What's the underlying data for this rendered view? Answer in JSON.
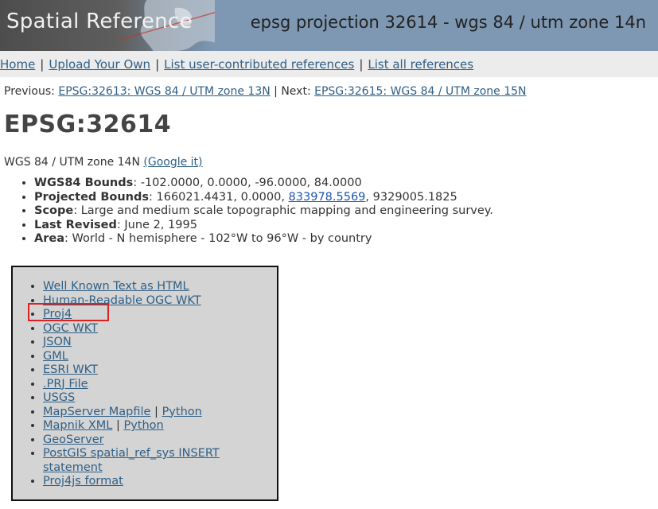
{
  "header": {
    "logo_text": "Spatial Reference",
    "title": "epsg projection 32614 - wgs 84 / utm zone 14n"
  },
  "nav": {
    "home": "Home",
    "upload": "Upload Your Own",
    "user_refs": "List user-contributed references",
    "all_refs": "List all references",
    "sep": "|"
  },
  "prevnext": {
    "prev_label": "Previous:",
    "prev_link": "EPSG:32613: WGS 84 / UTM zone 13N",
    "sep": " | Next: ",
    "next_link": "EPSG:32615: WGS 84 / UTM zone 15N"
  },
  "page": {
    "heading": "EPSG:32614",
    "name": "WGS 84 / UTM zone 14N",
    "google": "(Google it)"
  },
  "details": {
    "wgs_label": "WGS84 Bounds",
    "wgs_value": ": -102.0000, 0.0000, -96.0000, 84.0000",
    "proj_label": "Projected Bounds",
    "proj_pre": ": 166021.4431, 0.0000, ",
    "proj_link": "833978.5569",
    "proj_post": ", 9329005.1825",
    "scope_label": "Scope",
    "scope_value": ": Large and medium scale topographic mapping and engineering survey.",
    "revised_label": "Last Revised",
    "revised_value": ": June 2, 1995",
    "area_label": "Area",
    "area_value": ": World - N hemisphere - 102°W to 96°W - by country"
  },
  "formats": {
    "wkt_html": "Well Known Text as HTML",
    "human_ogc": "Human-Readable OGC WKT",
    "proj4": "Proj4",
    "ogc_wkt": "OGC WKT",
    "json": "JSON",
    "gml": "GML",
    "esri_wkt": "ESRI WKT",
    "prj": ".PRJ File",
    "usgs": "USGS",
    "mapserver": "MapServer Mapfile",
    "mapserver_python": "Python",
    "mapnik": "Mapnik XML",
    "mapnik_python": "Python",
    "geoserver": "GeoServer",
    "postgis": "PostGIS spatial_ref_sys INSERT statement",
    "proj4js": "Proj4js format",
    "pipe": " | "
  },
  "colors": {
    "link": "#2f5f86",
    "highlight": "#dd2222"
  }
}
